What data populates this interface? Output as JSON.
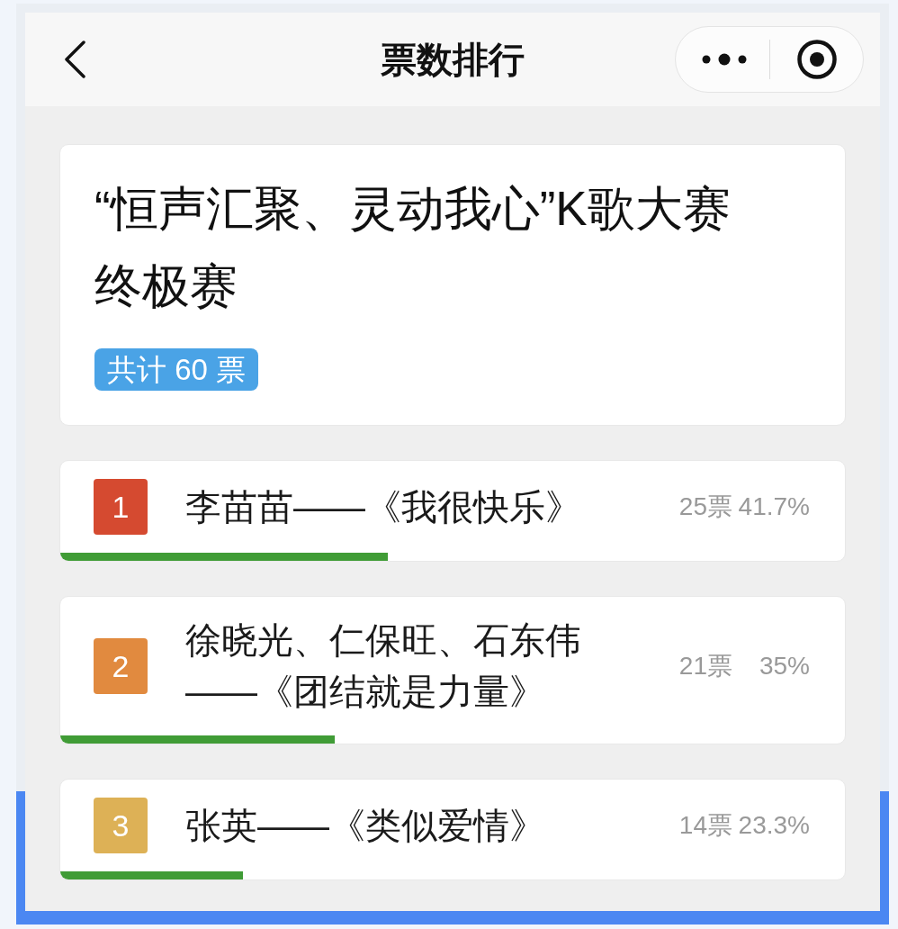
{
  "nav_bar": {
    "title": "票数排行"
  },
  "header_card": {
    "title": "“恒声汇聚、灵动我心”K歌大赛终极赛",
    "total_badge": "共计 60 票"
  },
  "rankings": [
    {
      "rank": "1",
      "color": "#d54a30",
      "name": "李苗苗——《我很快乐》",
      "votes": "25票",
      "percent": "41.7%",
      "level": 0.417
    },
    {
      "rank": "2",
      "color": "#e18a3f",
      "name": "徐晓光、仁保旺、石东伟——《团结就是力量》",
      "votes": "21票",
      "percent": "35%",
      "level": 0.35
    },
    {
      "rank": "3",
      "color": "#ddb156",
      "name": "张英——《类似爱情》",
      "votes": "14票",
      "percent": "23.3%",
      "level": 0.233
    }
  ]
}
